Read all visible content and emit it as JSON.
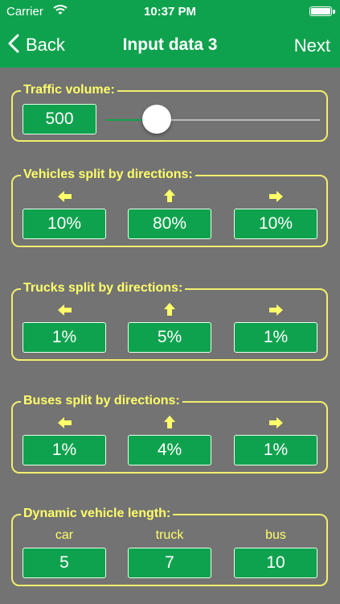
{
  "status_bar": {
    "carrier": "Carrier",
    "time": "10:37 PM"
  },
  "nav": {
    "back_label": "Back",
    "title": "Input data 3",
    "next_label": "Next"
  },
  "traffic_volume": {
    "label": "Traffic volume:",
    "value": "500",
    "slider_fraction": 0.23
  },
  "vehicles_split": {
    "label": "Vehicles split by directions:",
    "left": "10%",
    "straight": "80%",
    "right": "10%"
  },
  "trucks_split": {
    "label": "Trucks split by directions:",
    "left": "1%",
    "straight": "5%",
    "right": "1%"
  },
  "buses_split": {
    "label": "Buses split by directions:",
    "left": "1%",
    "straight": "4%",
    "right": "1%"
  },
  "dynamic_length": {
    "label": "Dynamic vehicle length:",
    "car_label": "car",
    "truck_label": "truck",
    "bus_label": "bus",
    "car": "5",
    "truck": "7",
    "bus": "10"
  },
  "colors": {
    "accent_green": "#0fa24e",
    "label_yellow": "#ffff6a",
    "border_yellow": "#f2ef6d",
    "background_gray": "#737373"
  },
  "icons": [
    "wifi-icon",
    "battery-icon",
    "back-chevron-icon",
    "arrow-left-icon",
    "arrow-up-icon",
    "arrow-right-icon"
  ]
}
